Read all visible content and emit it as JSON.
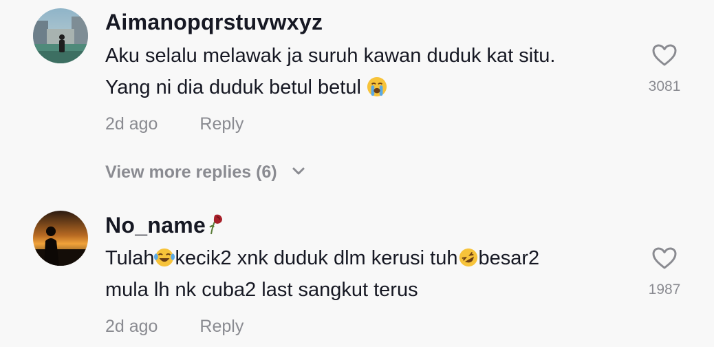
{
  "comments": [
    {
      "username": "Aimanopqrstuvwxyz",
      "lines": [
        "Aku selalu melawak ja suruh kawan duduk kat situ.",
        "Yang ni dia duduk betul betul"
      ],
      "date": "2d ago",
      "reply_label": "Reply",
      "likes": "3081",
      "avatar_icon": "avatar-photo-city",
      "trailing_emoji": "loudly-crying-face-emoji"
    },
    {
      "username": "No_name",
      "username_icon": "wilted-rose-emoji",
      "line1_part1": "Tulah",
      "line1_part2": "kecik2 xnk duduk dlm kerusi tuh",
      "line1_part3": "besar2",
      "line2": "mula lh nk cuba2 last sangkut terus",
      "date": "2d ago",
      "reply_label": "Reply",
      "likes": "1987",
      "avatar_icon": "avatar-photo-sunset",
      "emoji_1": "face-with-tears-of-joy-emoji",
      "emoji_2": "rolling-on-floor-laughing-emoji"
    }
  ],
  "view_more_replies": "View more replies (6)",
  "colors": {
    "background": "#f8f8f8",
    "text_primary": "#161823",
    "text_secondary": "#8a8b91"
  }
}
